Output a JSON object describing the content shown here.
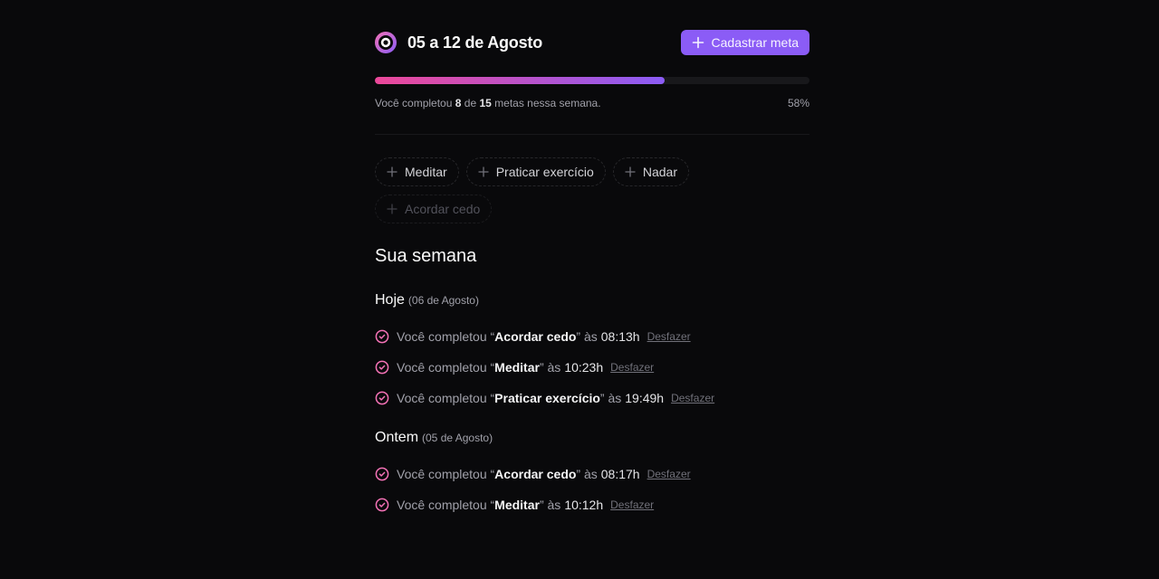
{
  "header": {
    "week_range": "05 a 12 de Agosto",
    "new_goal_button": "Cadastrar meta"
  },
  "progress": {
    "prefix": "Você completou",
    "completed": "8",
    "connector": "de",
    "total": "15",
    "suffix": "metas nessa semana.",
    "percent_label": "58%",
    "fraction": 0.667
  },
  "pending_goals": [
    {
      "label": "Meditar",
      "disabled": false
    },
    {
      "label": "Praticar exercício",
      "disabled": false
    },
    {
      "label": "Nadar",
      "disabled": false
    },
    {
      "label": "Acordar cedo",
      "disabled": true
    }
  ],
  "summary": {
    "heading": "Sua semana",
    "days": [
      {
        "label": "Hoje",
        "date": "(06 de Agosto)",
        "entries": [
          {
            "prefix": "Você completou “",
            "goal": "Acordar cedo",
            "mid": "” às",
            "time": "08:13h",
            "undo": "Desfazer"
          },
          {
            "prefix": "Você completou “",
            "goal": "Meditar",
            "mid": "” às",
            "time": "10:23h",
            "undo": "Desfazer"
          },
          {
            "prefix": "Você completou “",
            "goal": "Praticar exercício",
            "mid": "” às",
            "time": "19:49h",
            "undo": "Desfazer"
          }
        ]
      },
      {
        "label": "Ontem",
        "date": "(05 de Agosto)",
        "entries": [
          {
            "prefix": "Você completou “",
            "goal": "Acordar cedo",
            "mid": "” às",
            "time": "08:17h",
            "undo": "Desfazer"
          },
          {
            "prefix": "Você completou “",
            "goal": "Meditar",
            "mid": "” às",
            "time": "10:12h",
            "undo": "Desfazer"
          }
        ]
      }
    ]
  },
  "colors": {
    "background": "#09090b",
    "accent": "#8b5cf6",
    "accent_pink": "#ec4899",
    "check": "#f472b6"
  }
}
